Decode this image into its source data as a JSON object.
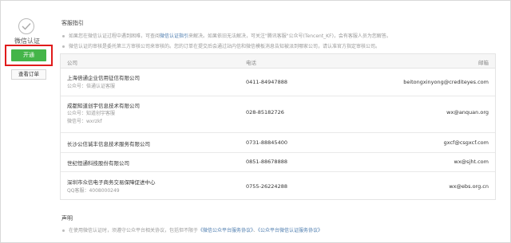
{
  "sidebar": {
    "status_label": "微信认证",
    "open_button": "开通",
    "view_orders_button": "查看订单",
    "accent_color": "#44b549",
    "highlight_color": "#e01b1b"
  },
  "guide": {
    "title": "客服指引",
    "line1_a": "如果您在微信认证过程中遇到困难，可查阅",
    "line1_link": "微信认证指引",
    "line1_b": "来解决。如果依旧无法解决，可关注\"腾讯客服\"公众号(Tencent_KF)，会有客服人员为您解答。",
    "line2": "微信认证的审核是委托第三方审核公司来审核的。您的订单在提交后会通过站内信和微信模板消息告知被派到哪家公司，请认准官方指定审核公司。"
  },
  "table": {
    "headers": {
      "company": "公司",
      "phone": "电话",
      "email": "邮箱"
    },
    "rows": [
      {
        "company": "上海倍通企业信用征信有限公司",
        "sub1": "公众号：倍通认证客服",
        "sub2": "",
        "phone": "0411-84947888",
        "email": "beitongxinyong@crediteyes.com"
      },
      {
        "company": "成都知道创宇信息技术有限公司",
        "sub1": "公众号：知道创宇客服",
        "sub2": "微信号：wxrzkf",
        "phone": "028-85182726",
        "email": "wx@anquan.org"
      },
      {
        "company": "长沙公信诚丰信息技术服务有限公司",
        "sub1": "",
        "sub2": "",
        "phone": "0731-88845400",
        "email": "gxcf@csgxcf.com"
      },
      {
        "company": "世纪恒通科技股份有限公司",
        "sub1": "",
        "sub2": "",
        "phone": "0851-88678888",
        "email": "wx@sjht.com"
      },
      {
        "company": "深圳市众信电子商务交易保障促进中心",
        "sub1": "QQ客服：4008000249",
        "sub2": "",
        "phone": "0755-26224288",
        "email": "wx@ebs.org.cn"
      }
    ]
  },
  "declaration": {
    "title": "声明",
    "text_a": "在使用微信认证时，须遵守公众平台相关协议，包括但不限于",
    "link1": "《微信公众平台服务协议》",
    "sep": "、",
    "link2": "《公众平台微信认证服务协议》"
  }
}
